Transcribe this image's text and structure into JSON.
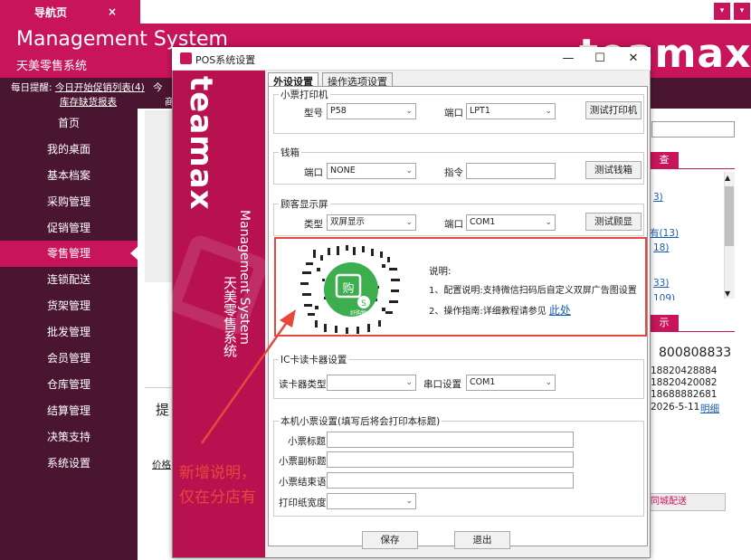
{
  "app": {
    "tab_label": "导航页",
    "tab_close": "×",
    "title": "Management System",
    "subtitle": "天美零售系统",
    "brand": "teamax",
    "win_min": "▾",
    "win_close": "▾"
  },
  "reminder": {
    "label": "每日提醒:",
    "link1": "今日开始促销列表(4)",
    "link2": "库存缺货报表",
    "cut1": "今",
    "cut2": "商"
  },
  "sidebar": {
    "items": [
      {
        "label": "首页"
      },
      {
        "label": "我的桌面"
      },
      {
        "label": "基本档案"
      },
      {
        "label": "采购管理"
      },
      {
        "label": "促销管理"
      },
      {
        "label": "零售管理"
      },
      {
        "label": "连锁配送"
      },
      {
        "label": "货架管理"
      },
      {
        "label": "批发管理"
      },
      {
        "label": "会员管理"
      },
      {
        "label": "仓库管理"
      },
      {
        "label": "结算管理"
      },
      {
        "label": "决策支持"
      },
      {
        "label": "系统设置"
      }
    ]
  },
  "content": {
    "partial1": "提",
    "partial2": "价格"
  },
  "right_panel": {
    "box1": "查",
    "lines": [
      "3)",
      "有(13)",
      "18)",
      "33)",
      "109)"
    ],
    "box2": "示",
    "phone_big": "800808833",
    "phone1": "18820428884",
    "phone2": "18820420082",
    "phone3": "18688882681",
    "date": "2026-5-11",
    "detail_link": "明细",
    "bottom_btn": "同城配送"
  },
  "dialog": {
    "title": "POS系统设置",
    "min": "—",
    "max": "☐",
    "close": "✕",
    "side_brand": "teamax",
    "side_en": "Management System",
    "side_cn": "天美零售系统",
    "tabs": [
      {
        "label": "外设设置"
      },
      {
        "label": "操作选项设置"
      }
    ],
    "printer": {
      "group": "小票打印机",
      "model_label": "型号",
      "model_value": "P58",
      "port_label": "端口",
      "port_value": "LPT1",
      "test_btn": "测试打印机"
    },
    "cashbox": {
      "group": "钱箱",
      "port_label": "端口",
      "port_value": "NONE",
      "cmd_label": "指令",
      "cmd_value": "",
      "test_btn": "测试钱箱"
    },
    "display": {
      "group": "顾客显示屏",
      "type_label": "类型",
      "type_value": "双屏显示",
      "port_label": "端口",
      "port_value": "COM1",
      "test_btn": "测试顾显"
    },
    "notes": {
      "heading": "说明:",
      "line1": "1、配置说明:支持微信扫码后自定义双屏广告图设置",
      "line2": "2、操作指南:详细教程请参见",
      "link": "此处",
      "qr_label": "好购物"
    },
    "card_reader": {
      "group": "IC卡读卡器设置",
      "type_label": "读卡器类型",
      "type_value": "",
      "port_label": "串口设置",
      "port_value": "COM1"
    },
    "receipt": {
      "group": "本机小票设置(填写后将会打印本标题)",
      "title_label": "小票标题",
      "subtitle_label": "小票副标题",
      "end_label": "小票结束语",
      "width_label": "打印纸宽度",
      "title_value": "",
      "subtitle_value": "",
      "end_value": "",
      "width_value": ""
    },
    "save_btn": "保存",
    "exit_btn": "退出"
  },
  "annotation": {
    "line1": "新增说明，",
    "line2": "仅在分店有"
  },
  "colors": {
    "brand": "#c8145a",
    "dark": "#4a1530",
    "annotation": "#e8473c",
    "qr_green": "#3cae4d"
  }
}
